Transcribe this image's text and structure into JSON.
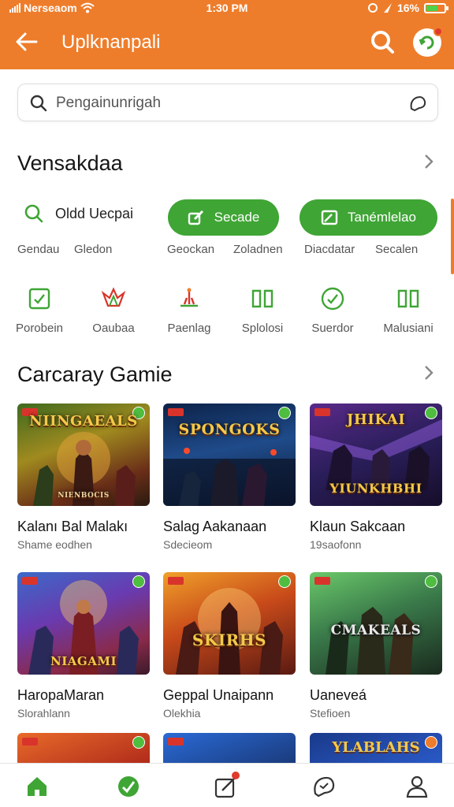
{
  "status_bar": {
    "carrier": "Nerseaom",
    "time": "1:30 PM",
    "battery": "16%"
  },
  "header": {
    "title": "Uplknanpali",
    "back_label": "back"
  },
  "search": {
    "placeholder": "Pengainunrigah"
  },
  "section1": {
    "title": "Vensakdaa"
  },
  "quick": {
    "plain_label": "Oldd Uecpai",
    "pill1_label": "Secade",
    "pill2_label": "Tanémlelao",
    "sub_labels": [
      "Gendau",
      "Gledon",
      "Geockan",
      "Zoladnen",
      "Diacdatar",
      "Secalen"
    ]
  },
  "categories": [
    "Porobein",
    "Oaubaa",
    "Paenlag",
    "Splolosi",
    "Suerdor",
    "Malusiani"
  ],
  "section2": {
    "title": "Carcaray Gamie"
  },
  "games": [
    {
      "name": "Kalanı Bal Malakı",
      "sub": "Shame eodhen",
      "art": "NIINGAEALS",
      "banner": "NIENBOCIS"
    },
    {
      "name": "Salag Aakanaan",
      "sub": "Sdecieom",
      "art": "SPONGOKS",
      "banner": ""
    },
    {
      "name": "Klaun Sakcaan",
      "sub": "19saofonn",
      "art": "JHIKAI",
      "banner": "YIUNKHBHI"
    },
    {
      "name": "HaropaMaran",
      "sub": "Slorahlann",
      "art": "NIAGAMI",
      "banner": ""
    },
    {
      "name": "Geppal Unaipann",
      "sub": "Olekhia",
      "art": "SKIRHS",
      "banner": ""
    },
    {
      "name": "Uaneveá",
      "sub": "Stefioen",
      "art": "CMAKEALS",
      "banner": ""
    }
  ],
  "partial_games": [
    {
      "art": ""
    },
    {
      "art": ""
    },
    {
      "art": "YLABLAHS"
    }
  ],
  "colors": {
    "accent": "#ee7d2b",
    "green": "#3fa535",
    "alert": "#e03a2d"
  },
  "icons": {
    "nav": [
      "home-icon",
      "check-circle-icon",
      "edit-icon",
      "chat-icon",
      "profile-icon"
    ]
  }
}
